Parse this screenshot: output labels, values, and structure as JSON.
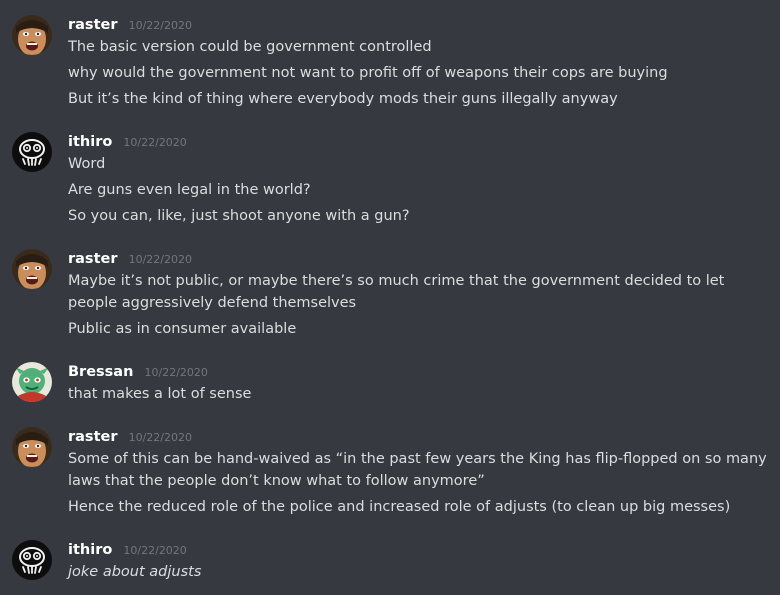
{
  "messages": [
    {
      "username": "raster",
      "timestamp": "10/22/2020",
      "avatar": "raster-avatar",
      "lines": [
        "The basic version could be government controlled",
        "why would the government not want to profit off of weapons their cops are buying",
        "But it’s the kind of thing where everybody mods their guns illegally anyway"
      ]
    },
    {
      "username": "ithiro",
      "timestamp": "10/22/2020",
      "avatar": "ithiro-avatar",
      "lines": [
        "Word",
        "Are guns even legal in the world?",
        "So you can, like, just shoot anyone with a gun?"
      ]
    },
    {
      "username": "raster",
      "timestamp": "10/22/2020",
      "avatar": "raster-avatar",
      "lines": [
        "Maybe it’s not public, or maybe there’s so much crime that the government decided to let people aggressively defend themselves",
        "Public as in consumer available"
      ]
    },
    {
      "username": "Bressan",
      "timestamp": "10/22/2020",
      "avatar": "bressan-avatar",
      "lines": [
        "that makes a lot of sense"
      ]
    },
    {
      "username": "raster",
      "timestamp": "10/22/2020",
      "avatar": "raster-avatar",
      "lines": [
        "Some of this can be hand-waived as “in the past few years the King has flip-flopped on so many laws that the people don’t know what to follow anymore”",
        "Hence the reduced role of the police and increased role of adjusts (to clean up big messes)"
      ]
    },
    {
      "username": "ithiro",
      "timestamp": "10/22/2020",
      "avatar": "ithiro-avatar",
      "lines": [
        "joke about adjusts"
      ]
    }
  ],
  "colors": {
    "background": "#36393f",
    "username": "#ffffff",
    "timestamp": "#72767d",
    "text": "#dcddde"
  }
}
